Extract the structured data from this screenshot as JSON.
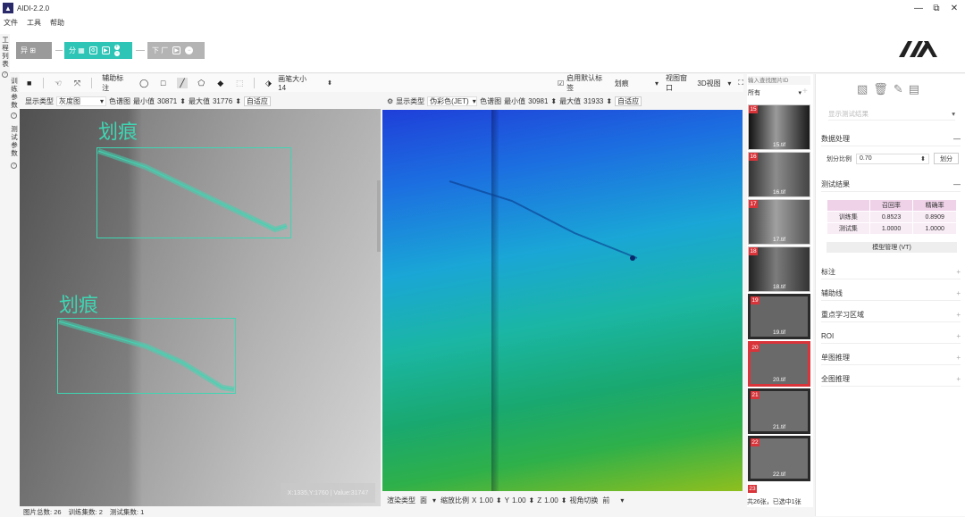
{
  "app": {
    "title": "AIDI-2.2.0",
    "logo": "AIDI"
  },
  "menu": [
    "文件",
    "工具",
    "帮助"
  ],
  "window_controls": {
    "minimize": "—",
    "maximize": "⧉",
    "close": "✕"
  },
  "pipeline": {
    "stage1": {
      "label": "异 ⊞"
    },
    "stage2": {
      "label": "分 ▦"
    },
    "stage3": {
      "label": "下 厂"
    }
  },
  "left_tabs": [
    {
      "label": "工程列表"
    },
    {
      "label": "训练参数"
    },
    {
      "label": "测试参数"
    }
  ],
  "toolbar": {
    "show_label": "辅助标注",
    "brush_label": "画笔大小 14",
    "use_default_label": "启用默认标签",
    "default_label_value": "划痕",
    "view_window_label": "视图窗口",
    "view_mode": "3D视图"
  },
  "left_view": {
    "display_type_label": "显示类型",
    "display_type_value": "灰度图",
    "color_map_label": "色谱图",
    "min_label": "最小值",
    "min_value": "30871",
    "max_label": "最大值",
    "max_value": "31776",
    "adaptive_label": "自适应",
    "annotations": [
      {
        "label": "划痕"
      },
      {
        "label": "划痕"
      }
    ],
    "coord_readout": "X:1335,Y:1760 | Value:31747"
  },
  "right_view": {
    "display_type_label": "显示类型",
    "display_type_value": "伪彩色(JET)",
    "color_map_label": "色谱图",
    "min_label": "最小值",
    "min_value": "30981",
    "max_label": "最大值",
    "max_value": "31933",
    "adaptive_label": "自适应",
    "bottom": {
      "render_label": "渲染类型",
      "render_value": "面",
      "scale_label": "缩放比例",
      "x_label": "X",
      "x_value": "1.00",
      "y_label": "Y",
      "y_value": "1.00",
      "z_label": "Z",
      "z_value": "1.00",
      "view_switch_label": "视角切换",
      "view_value": "前"
    }
  },
  "thumbnails": {
    "search_placeholder": "输入查找图片ID",
    "filter_value": "所有",
    "items": [
      {
        "index": "15",
        "name": "15.tif",
        "selected": false
      },
      {
        "index": "16",
        "name": "16.tif",
        "selected": false
      },
      {
        "index": "17",
        "name": "17.tif",
        "selected": false
      },
      {
        "index": "18",
        "name": "18.tif",
        "selected": false
      },
      {
        "index": "19",
        "name": "19.tif",
        "selected": false
      },
      {
        "index": "20",
        "name": "20.tif",
        "selected": true
      },
      {
        "index": "21",
        "name": "21.tif",
        "selected": false
      },
      {
        "index": "22",
        "name": "22.tif",
        "selected": false
      },
      {
        "index": "23",
        "name": "",
        "selected": false
      }
    ],
    "summary": "共26张，已选中1张"
  },
  "status": {
    "total_label": "图片总数:",
    "total_value": "26",
    "train_label": "训练集数:",
    "train_value": "2",
    "test_label": "测试集数:",
    "test_value": "1"
  },
  "right_panel": {
    "result_select_placeholder": "显示测试结果",
    "data_processing": {
      "title": "数据处理",
      "ratio_label": "划分比例",
      "ratio_value": "0.70",
      "split_button": "划分"
    },
    "test_results": {
      "title": "测试结果",
      "headers": [
        "",
        "召回率",
        "精确率"
      ],
      "rows": [
        [
          "训练集",
          "0.8523",
          "0.8909"
        ],
        [
          "测试集",
          "1.0000",
          "1.0000"
        ]
      ],
      "manage_button": "模型管理 (VT)"
    },
    "sections": [
      "标注",
      "辅助线",
      "重点学习区域",
      "ROI",
      "单图推理",
      "全图推理"
    ]
  },
  "colors": {
    "accent": "#2ec4b6",
    "badge": "#d9343a",
    "annotation": "#3fd6b3"
  }
}
